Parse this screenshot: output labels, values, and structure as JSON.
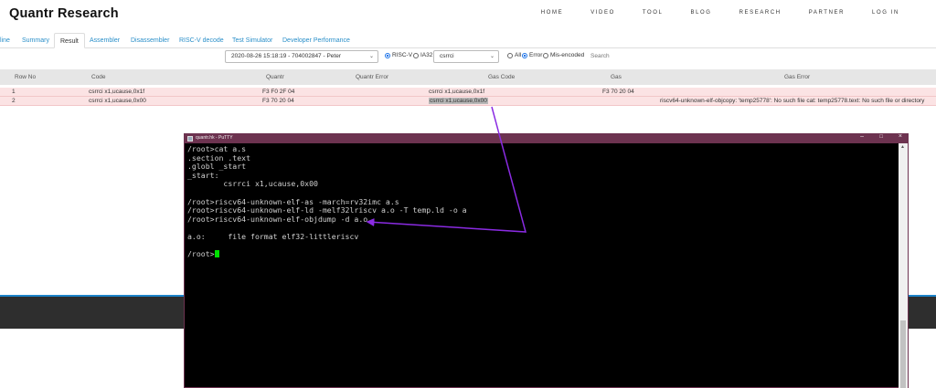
{
  "site": {
    "brand": "Quantr Research",
    "nav": [
      "HOME",
      "VIDEO",
      "TOOL",
      "BLOG",
      "RESEARCH",
      "PARTNER",
      "LOG IN"
    ]
  },
  "tabs": [
    "line",
    "Summary",
    "Result",
    "Assembler",
    "Disassembler",
    "RISC-V decode",
    "Test Simulator",
    "Developer Performance"
  ],
  "active_tab": "Result",
  "filters": {
    "run_select": "2020-08-26 15:18:19 - 704002847 - Peter",
    "arch_options": [
      "RISC-V",
      "IA32"
    ],
    "arch_selected": "RISC-V",
    "instr_select": "csrrci",
    "status_options": [
      "All",
      "Error",
      "Mis-encoded"
    ],
    "status_selected": "Error",
    "search_placeholder": "Search"
  },
  "table": {
    "columns": [
      "Row No",
      "Code",
      "Quantr",
      "Quantr Error",
      "Gas Code",
      "Gas",
      "Gas Error"
    ],
    "rows": [
      {
        "row_no": "1",
        "code": "csrrci x1,ucause,0x1f",
        "quantr": "F3 F0 2F 04",
        "quantr_error": "",
        "gas_code": "csrrci x1,ucause,0x1f",
        "gas": "F3 70 20 04",
        "gas_error": ""
      },
      {
        "row_no": "2",
        "code": "csrrci x1,ucause,0x00",
        "quantr": "F3 70 20 04",
        "quantr_error": "",
        "gas_code": "csrrci x1,ucause,0x00",
        "gas": "",
        "gas_error": "riscv64-unknown-elf-objcopy: 'temp25778': No such file cat: temp25778.text: No such file or directory"
      }
    ]
  },
  "putty": {
    "title": "quantr.hk - PuTTY",
    "lines": [
      "/root>cat a.s",
      ".section .text",
      ".globl _start",
      "_start:",
      "        csrrci x1,ucause,0x00",
      "",
      "/root>riscv64-unknown-elf-as -march=rv32imc a.s",
      "/root>riscv64-unknown-elf-ld -melf32lriscv a.o -T temp.ld -o a",
      "/root>riscv64-unknown-elf-objdump -d a.o",
      "",
      "a.o:     file format elf32-littleriscv",
      "",
      "/root>"
    ]
  },
  "colors": {
    "link": "#2a8fc9",
    "error_row": "#fbe3e4",
    "putty_titlebar": "#6d3350",
    "cursor": "#00e000",
    "arrow": "#8a2be2",
    "footer_band": "#2e2e2e",
    "footer_accent": "#1d84c9"
  }
}
